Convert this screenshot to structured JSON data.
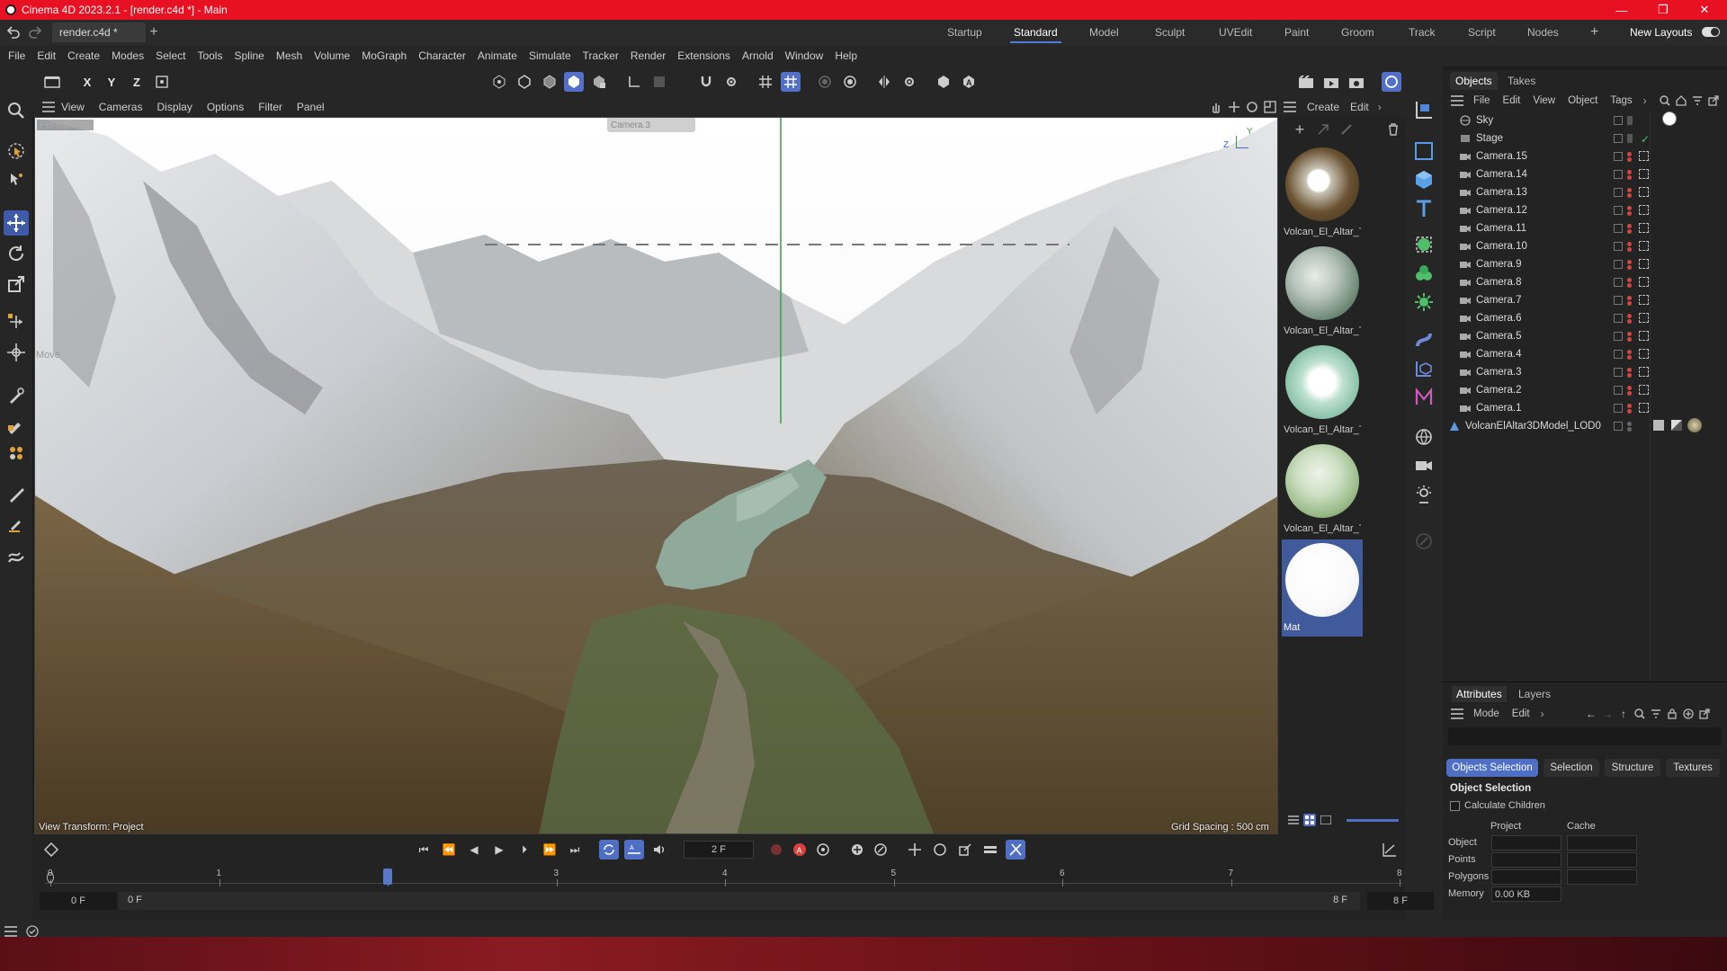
{
  "window": {
    "title": "Cinema 4D 2023.2.1 - [render.c4d *] - Main",
    "minimize": "—",
    "maximize": "❐",
    "close": "✕"
  },
  "tabs": {
    "document": "render.c4d *",
    "layouts": [
      "Startup",
      "Standard",
      "Model",
      "Sculpt",
      "UVEdit",
      "Paint",
      "Groom",
      "Track",
      "Script",
      "Nodes"
    ],
    "active_layout": "Standard",
    "add": "+",
    "new_layouts": "New Layouts"
  },
  "menubar": [
    "File",
    "Edit",
    "Create",
    "Modes",
    "Select",
    "Tools",
    "Spline",
    "Mesh",
    "Volume",
    "MoGraph",
    "Character",
    "Animate",
    "Simulate",
    "Tracker",
    "Render",
    "Extensions",
    "Arnold",
    "Window",
    "Help"
  ],
  "toolbar": {
    "axis_x": "X",
    "axis_y": "Y",
    "axis_z": "Z"
  },
  "viewport": {
    "menu": [
      "View",
      "Cameras",
      "Display",
      "Options",
      "Filter",
      "Panel"
    ],
    "label": "Perspective",
    "camera": "Camera.3",
    "move_label": "Move",
    "axis_z": "Z",
    "axis_y": "Y",
    "view_transform": "View Transform: Project",
    "grid_spacing": "Grid Spacing : 500 cm"
  },
  "materials": {
    "menu": [
      "Create",
      "Edit"
    ],
    "items": [
      {
        "label": "Volcan_El_Altar_Te"
      },
      {
        "label": "Volcan_El_Altar_Te"
      },
      {
        "label": "Volcan_El_Altar_Te"
      },
      {
        "label": "Volcan_El_Altar_Te"
      },
      {
        "label": "Mat"
      }
    ]
  },
  "objects": {
    "tabs": [
      "Objects",
      "Takes"
    ],
    "menu": [
      "File",
      "Edit",
      "View",
      "Object",
      "Tags"
    ],
    "items": [
      {
        "name": "Sky"
      },
      {
        "name": "Stage"
      },
      {
        "name": "Camera.15"
      },
      {
        "name": "Camera.14"
      },
      {
        "name": "Camera.13"
      },
      {
        "name": "Camera.12"
      },
      {
        "name": "Camera.11"
      },
      {
        "name": "Camera.10"
      },
      {
        "name": "Camera.9"
      },
      {
        "name": "Camera.8"
      },
      {
        "name": "Camera.7"
      },
      {
        "name": "Camera.6"
      },
      {
        "name": "Camera.5"
      },
      {
        "name": "Camera.4"
      },
      {
        "name": "Camera.3"
      },
      {
        "name": "Camera.2"
      },
      {
        "name": "Camera.1"
      },
      {
        "name": "VolcanElAltar3DModel_LOD0"
      }
    ]
  },
  "attributes": {
    "tabs": [
      "Attributes",
      "Layers"
    ],
    "menu": [
      "Mode",
      "Edit"
    ],
    "sub_tabs": [
      "Objects Selection",
      "Selection",
      "Structure",
      "Textures"
    ],
    "heading": "Object Selection",
    "calculate_children": "Calculate Children",
    "col_project": "Project",
    "col_cache": "Cache",
    "row_object": "Object",
    "row_points": "Points",
    "row_polygons": "Polygons",
    "row_memory": "Memory",
    "memory_value": "0.00 KB"
  },
  "timeline": {
    "current_frame": "2 F",
    "ticks": [
      "0",
      "1",
      "2",
      "3",
      "4",
      "5",
      "6",
      "7",
      "8"
    ],
    "start": "0 F",
    "range_start": "0 F",
    "range_end": "8 F",
    "end": "8 F",
    "playhead_frame": 2,
    "max_frame": 8
  },
  "colors": {
    "accent": "#4f6fc5",
    "title_bar": "#e81123"
  }
}
